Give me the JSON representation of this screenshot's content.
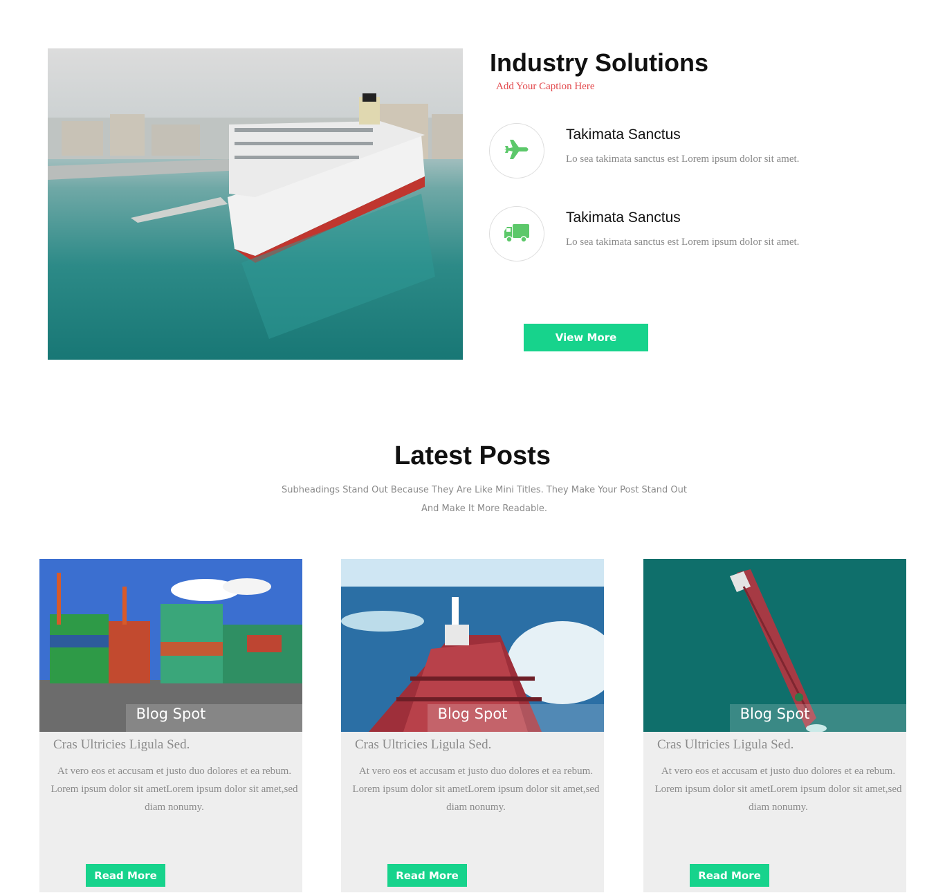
{
  "industry": {
    "title": "Industry Solutions",
    "caption": "Add Your Caption Here",
    "features": [
      {
        "icon": "airplane-icon",
        "title": "Takimata Sanctus",
        "text": "Lo sea takimata sanctus est Lorem ipsum dolor sit amet."
      },
      {
        "icon": "truck-icon",
        "title": "Takimata Sanctus",
        "text": "Lo sea takimata sanctus est Lorem ipsum dolor sit amet."
      }
    ],
    "button_label": "View More",
    "accent_color": "#17d38c",
    "icon_color": "#5cc86a"
  },
  "posts": {
    "title": "Latest Posts",
    "subtitle": "Subheadings Stand Out Because They Are Like Mini Titles. They Make Your Post Stand Out And Make It More Readable.",
    "cards": [
      {
        "image": "container-yard-photo",
        "overlay_label": "Blog Spot",
        "title": "Cras Ultricies Ligula Sed.",
        "text": "At vero eos et accusam et justo duo dolores et ea rebum. Lorem ipsum dolor sit ametLorem ipsum dolor sit amet,sed diam nonumy.",
        "button_label": "Read More"
      },
      {
        "image": "tanker-deck-photo",
        "overlay_label": "Blog Spot",
        "title": "Cras Ultricies Ligula Sed.",
        "text": "At vero eos et accusam et justo duo dolores et ea rebum. Lorem ipsum dolor sit ametLorem ipsum dolor sit amet,sed diam nonumy.",
        "button_label": "Read More"
      },
      {
        "image": "aerial-tanker-photo",
        "overlay_label": "Blog Spot",
        "title": "Cras Ultricies Ligula Sed.",
        "text": "At vero eos et accusam et justo duo dolores et ea rebum. Lorem ipsum dolor sit ametLorem ipsum dolor sit amet,sed diam nonumy.",
        "button_label": "Read More"
      }
    ]
  }
}
